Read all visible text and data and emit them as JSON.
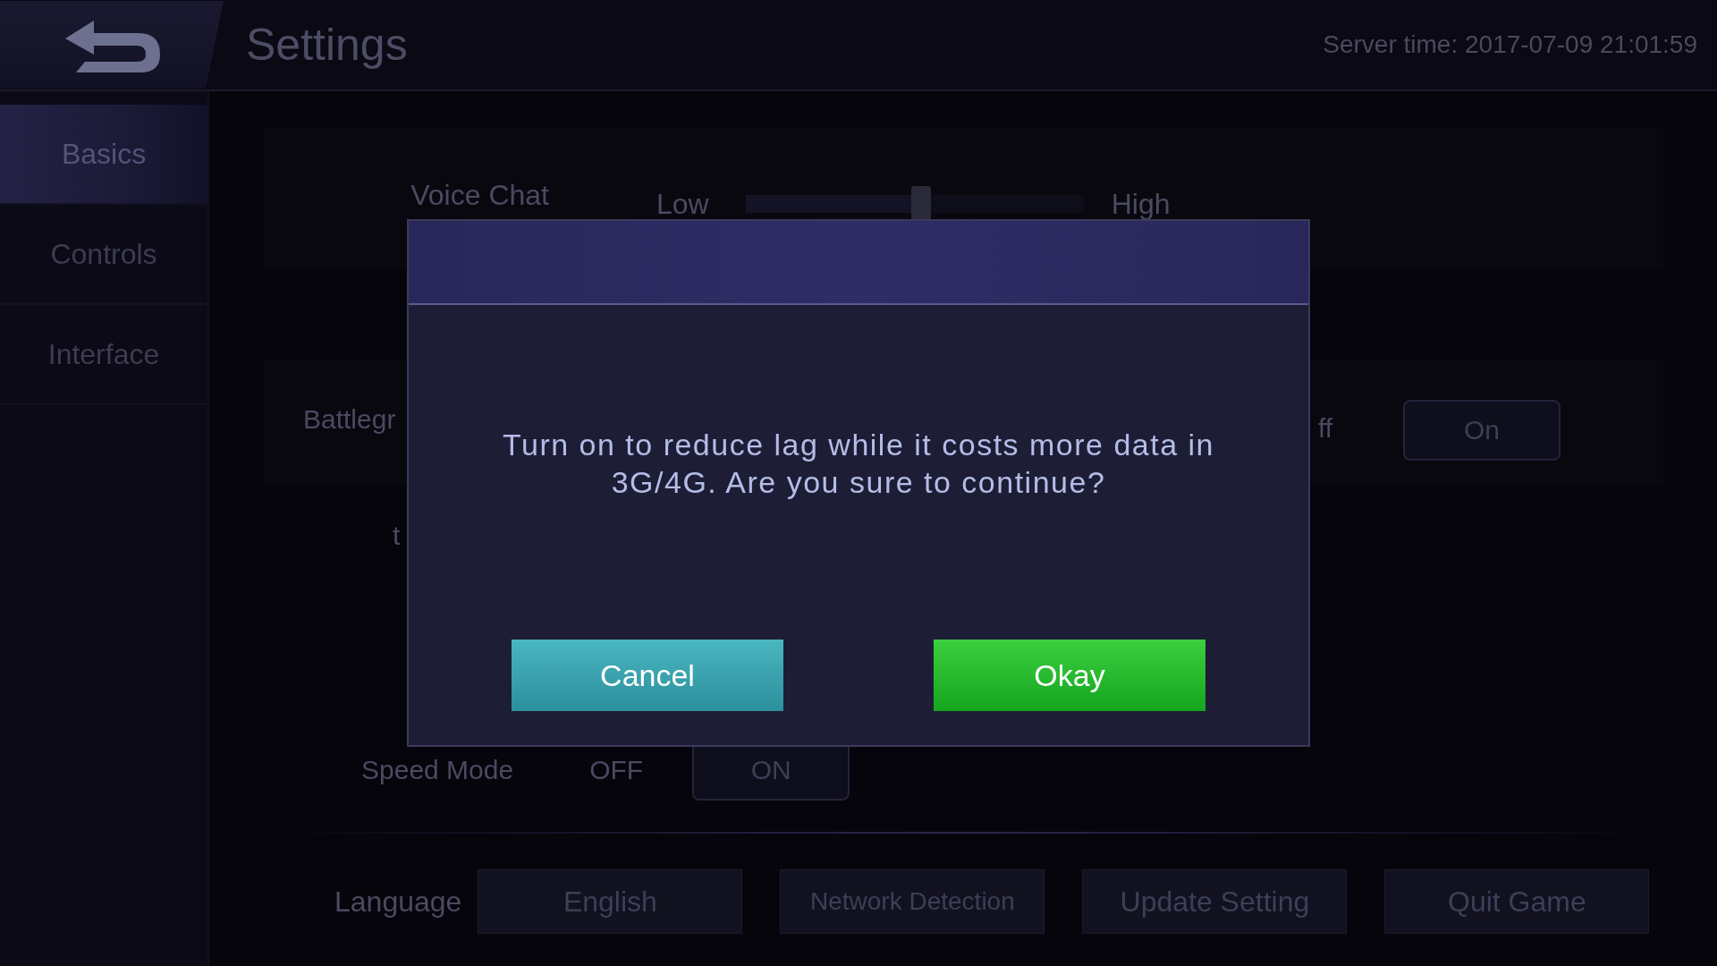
{
  "header": {
    "title": "Settings",
    "server_time": "Server time: 2017-07-09 21:01:59"
  },
  "sidebar": {
    "items": [
      {
        "label": "Basics",
        "selected": true
      },
      {
        "label": "Controls",
        "selected": false
      },
      {
        "label": "Interface",
        "selected": false
      }
    ]
  },
  "settings": {
    "voice_chat": {
      "label": "Voice Chat",
      "low": "Low",
      "high": "High",
      "level": 0.52
    },
    "battleground_row": {
      "label": "Battlegr",
      "option_1": "ff",
      "option_2": "On"
    },
    "row_3": {
      "label": "t"
    },
    "speed_mode": {
      "label": "Speed Mode",
      "off": "OFF",
      "on": "ON"
    }
  },
  "footer": {
    "language_label": "Language",
    "buttons": [
      "English",
      "Network Detection",
      "Update Setting",
      "Quit Game"
    ]
  },
  "dialog": {
    "message": "Turn on to reduce lag while it costs more data in 3G/4G. Are you sure to continue?",
    "buttons": [
      {
        "label": "Cancel",
        "kind": "secondary"
      },
      {
        "label": "Okay",
        "kind": "primary"
      }
    ]
  }
}
